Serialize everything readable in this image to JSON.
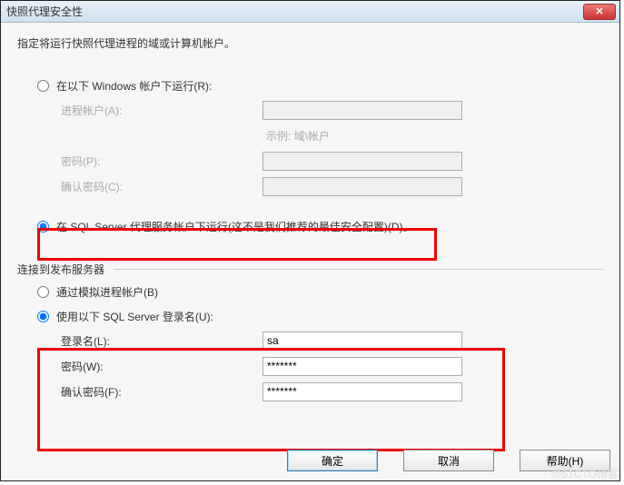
{
  "titlebar": {
    "title": "快照代理安全性",
    "close": "✕"
  },
  "desc": "指定将运行快照代理进程的域或计算机帐户。",
  "run_section": {
    "opt_windows": "在以下 Windows 帐户下运行(R):",
    "process_account_label": "进程帐户(A):",
    "process_account_value": "",
    "example_hint": "示例: 域\\帐户",
    "password_label": "密码(P):",
    "password_value": "",
    "confirm_label": "确认密码(C):",
    "confirm_value": "",
    "opt_sql": "在 SQL Server 代理服务帐户下运行(这不是我们推荐的最佳安全配置)(D)。"
  },
  "connect_section": {
    "heading": "连接到发布服务器",
    "opt_impersonate": "通过模拟进程帐户(B)",
    "opt_sql_login": "使用以下 SQL Server 登录名(U):",
    "login_label": "登录名(L):",
    "login_value": "sa",
    "password_label": "密码(W):",
    "password_value": "*******",
    "confirm_label": "确认密码(F):",
    "confirm_value": "*******"
  },
  "buttons": {
    "ok": "确定",
    "cancel": "取消",
    "help": "帮助(H)"
  },
  "watermark": "@51CTO博客"
}
